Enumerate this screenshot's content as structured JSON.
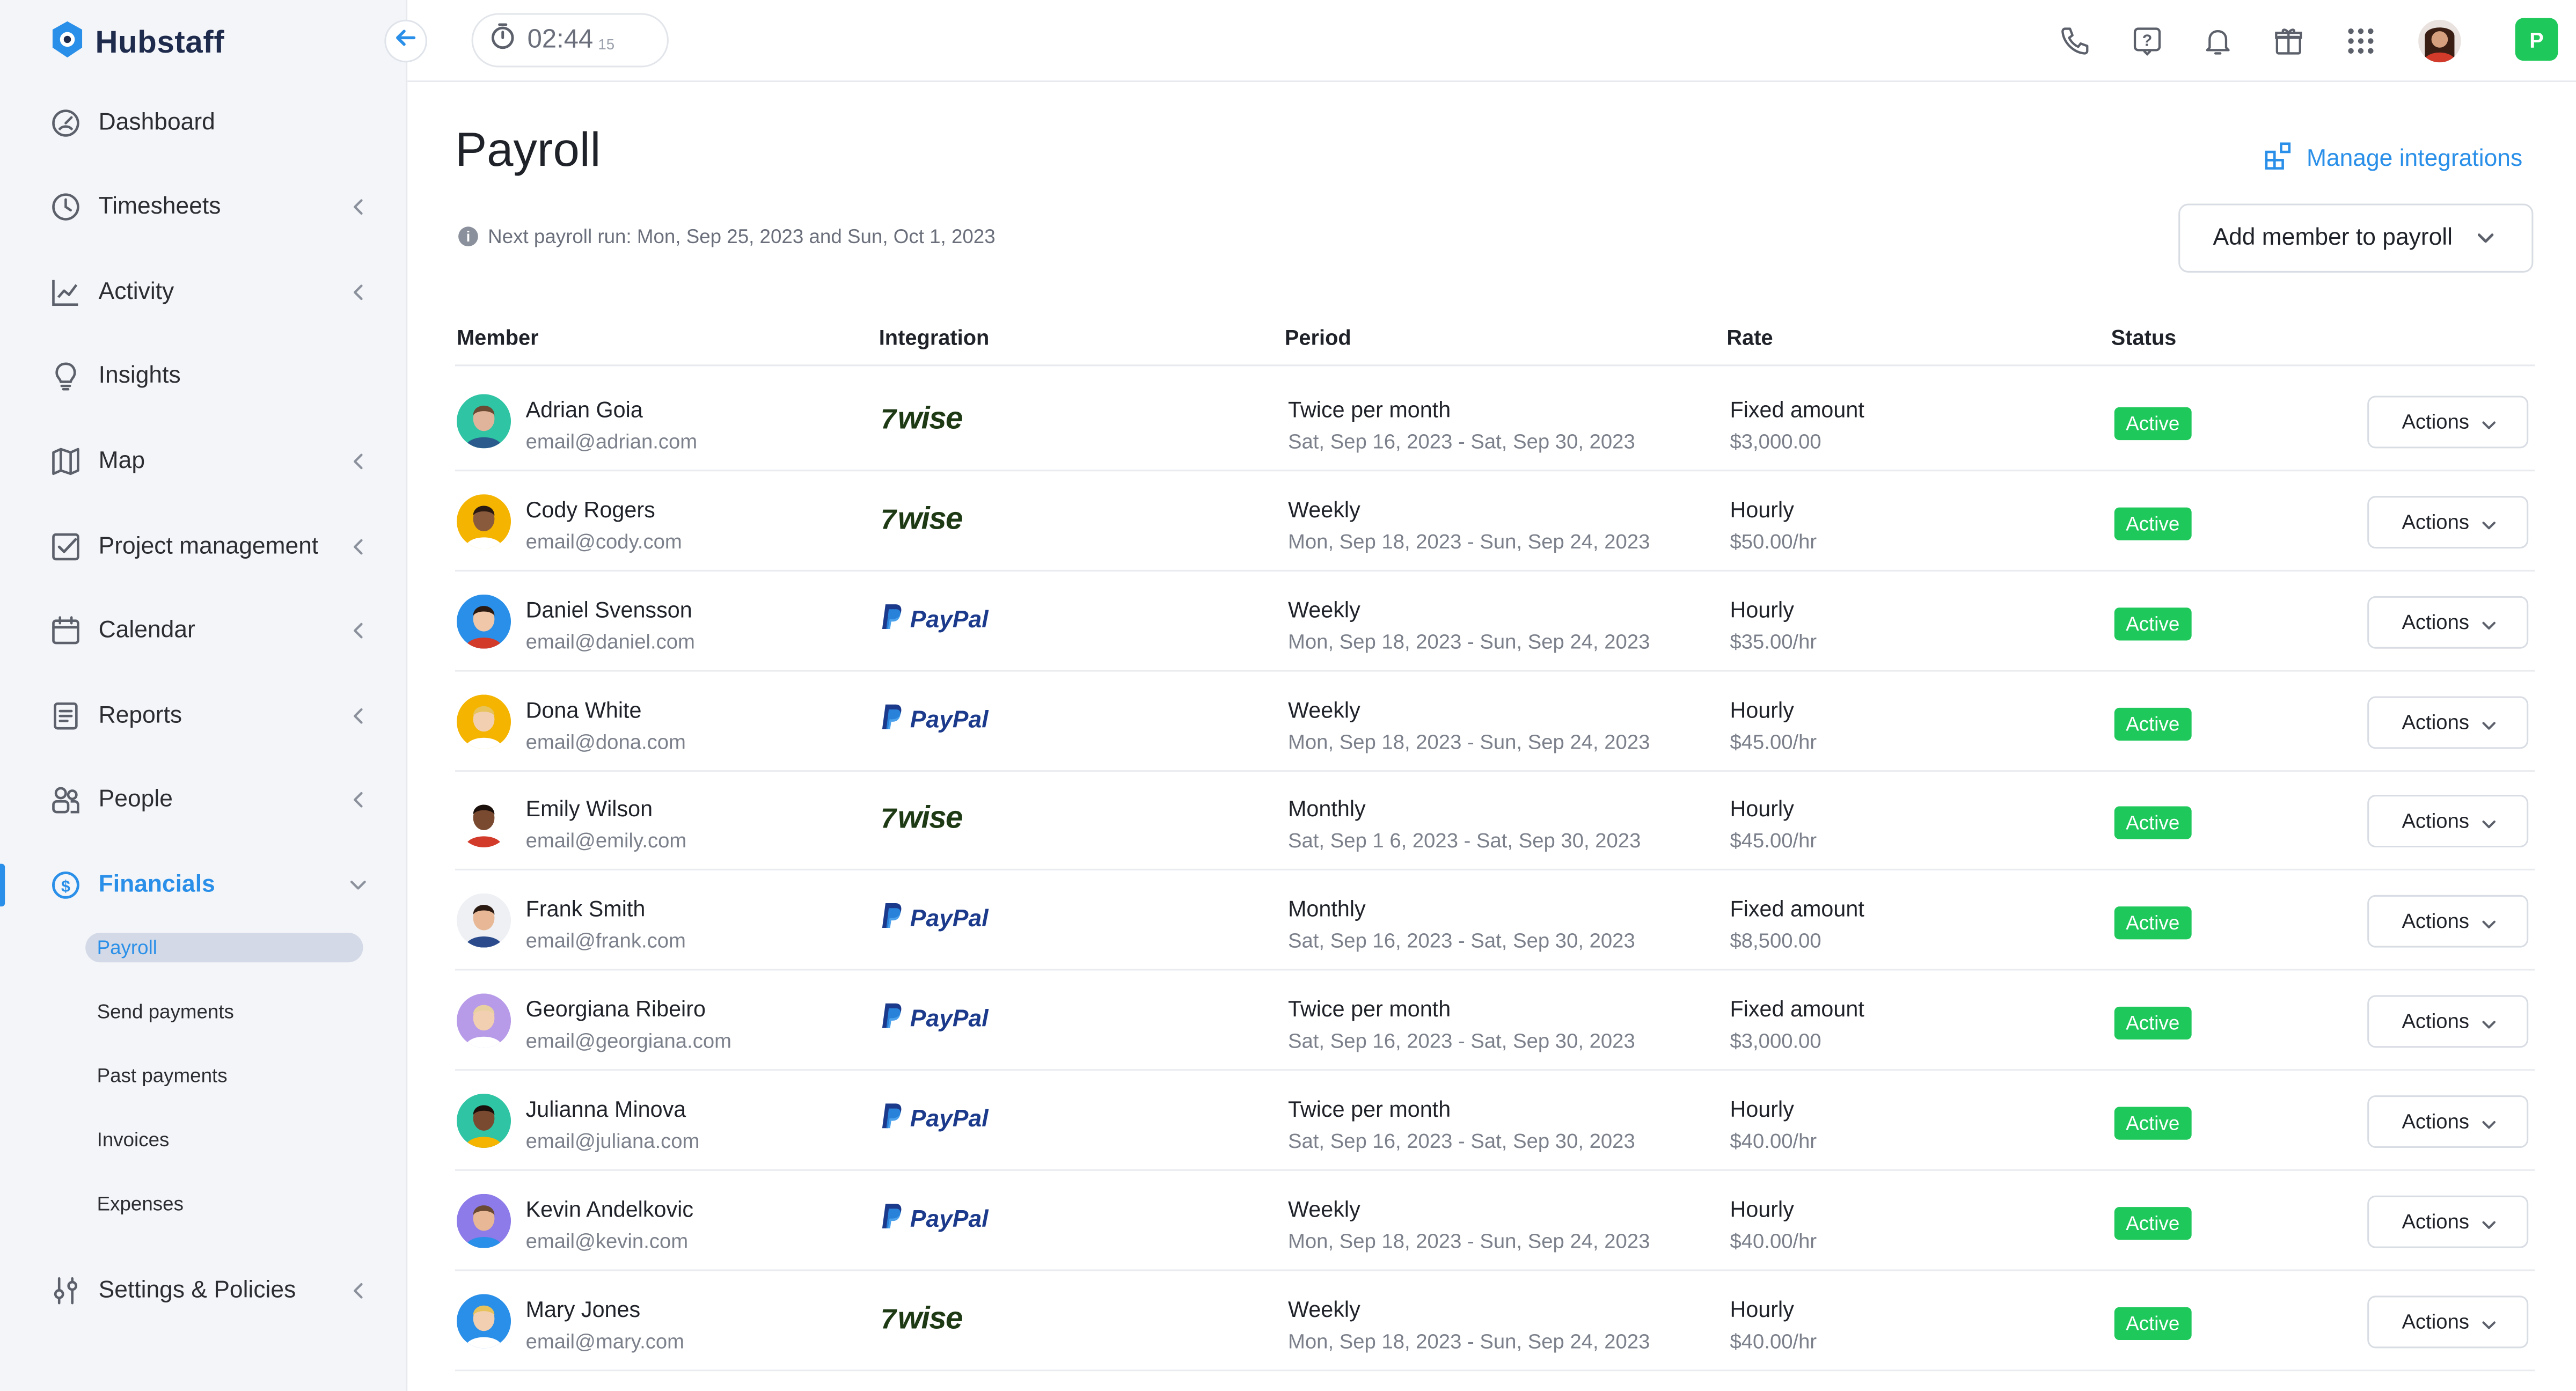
{
  "app": {
    "name": "Hubstaff"
  },
  "timer": {
    "time": "02:44",
    "seconds": "15"
  },
  "sidebar": {
    "items": [
      {
        "label": "Dashboard"
      },
      {
        "label": "Timesheets"
      },
      {
        "label": "Activity"
      },
      {
        "label": "Insights"
      },
      {
        "label": "Map"
      },
      {
        "label": "Project management"
      },
      {
        "label": "Calendar"
      },
      {
        "label": "Reports"
      },
      {
        "label": "People"
      },
      {
        "label": "Financials"
      },
      {
        "label": "Settings & Policies"
      }
    ],
    "financials_sub": [
      {
        "label": "Payroll"
      },
      {
        "label": "Send payments"
      },
      {
        "label": "Past payments"
      },
      {
        "label": "Invoices"
      },
      {
        "label": "Expenses"
      }
    ]
  },
  "topbar": {
    "org_initial": "P"
  },
  "page": {
    "title": "Payroll",
    "manage_integrations": "Manage integrations",
    "next_run": "Next payroll run: Mon, Sep 25, 2023 and Sun, Oct 1, 2023",
    "add_member": "Add member to payroll"
  },
  "table": {
    "headers": [
      "Member",
      "Integration",
      "Period",
      "Rate",
      "Status"
    ],
    "actions_label": "Actions",
    "rows": [
      {
        "name": "Adrian Goia",
        "email": "email@adrian.com",
        "integration": "wise",
        "integration_label": "wise",
        "period": "Twice per month",
        "range": "Sat, Sep 16, 2023 - Sat, Sep 30, 2023",
        "rate_type": "Fixed amount",
        "rate": "$3,000.00",
        "status": "Active"
      },
      {
        "name": "Cody Rogers",
        "email": "email@cody.com",
        "integration": "wise",
        "integration_label": "wise",
        "period": "Weekly",
        "range": "Mon, Sep 18, 2023 - Sun, Sep 24, 2023",
        "rate_type": "Hourly",
        "rate": "$50.00/hr",
        "status": "Active"
      },
      {
        "name": "Daniel Svensson",
        "email": "email@daniel.com",
        "integration": "paypal",
        "integration_label": "PayPal",
        "period": "Weekly",
        "range": "Mon, Sep 18, 2023 - Sun, Sep 24, 2023",
        "rate_type": "Hourly",
        "rate": "$35.00/hr",
        "status": "Active"
      },
      {
        "name": "Dona White",
        "email": "email@dona.com",
        "integration": "paypal",
        "integration_label": "PayPal",
        "period": "Weekly",
        "range": "Mon, Sep 18, 2023 - Sun, Sep 24, 2023",
        "rate_type": "Hourly",
        "rate": "$45.00/hr",
        "status": "Active"
      },
      {
        "name": "Emily Wilson",
        "email": "email@emily.com",
        "integration": "wise",
        "integration_label": "wise",
        "period": "Monthly",
        "range": "Sat, Sep 1  6, 2023 - Sat, Sep 30, 2023",
        "rate_type": "Hourly",
        "rate": "$45.00/hr",
        "status": "Active"
      },
      {
        "name": "Frank Smith",
        "email": "email@frank.com",
        "integration": "paypal",
        "integration_label": "PayPal",
        "period": "Monthly",
        "range": "Sat, Sep 16, 2023 - Sat, Sep 30, 2023",
        "rate_type": "Fixed amount",
        "rate": "$8,500.00",
        "status": "Active"
      },
      {
        "name": "Georgiana Ribeiro",
        "email": "email@georgiana.com",
        "integration": "paypal",
        "integration_label": "PayPal",
        "period": "Twice per month",
        "range": "Sat, Sep 16, 2023 - Sat, Sep 30, 2023",
        "rate_type": "Fixed amount",
        "rate": "$3,000.00",
        "status": "Active"
      },
      {
        "name": "Julianna Minova",
        "email": "email@juliana.com",
        "integration": "paypal",
        "integration_label": "PayPal",
        "period": "Twice per month",
        "range": "Sat, Sep 16, 2023 - Sat, Sep 30, 2023",
        "rate_type": "Hourly",
        "rate": "$40.00/hr",
        "status": "Active"
      },
      {
        "name": "Kevin Andelkovic",
        "email": "email@kevin.com",
        "integration": "paypal",
        "integration_label": "PayPal",
        "period": "Weekly",
        "range": "Mon, Sep 18, 2023 - Sun, Sep 24, 2023",
        "rate_type": "Hourly",
        "rate": "$40.00/hr",
        "status": "Active"
      },
      {
        "name": "Mary Jones",
        "email": "email@mary.com",
        "integration": "wise",
        "integration_label": "wise",
        "period": "Weekly",
        "range": "Mon, Sep 18, 2023 - Sun, Sep 24, 2023",
        "rate_type": "Hourly",
        "rate": "$40.00/hr",
        "status": "Active"
      }
    ]
  },
  "colors": {
    "accent": "#2a8fe8",
    "active": "#1ec85a",
    "wise": "#1d3a14",
    "paypal": "#1b3a8c"
  }
}
